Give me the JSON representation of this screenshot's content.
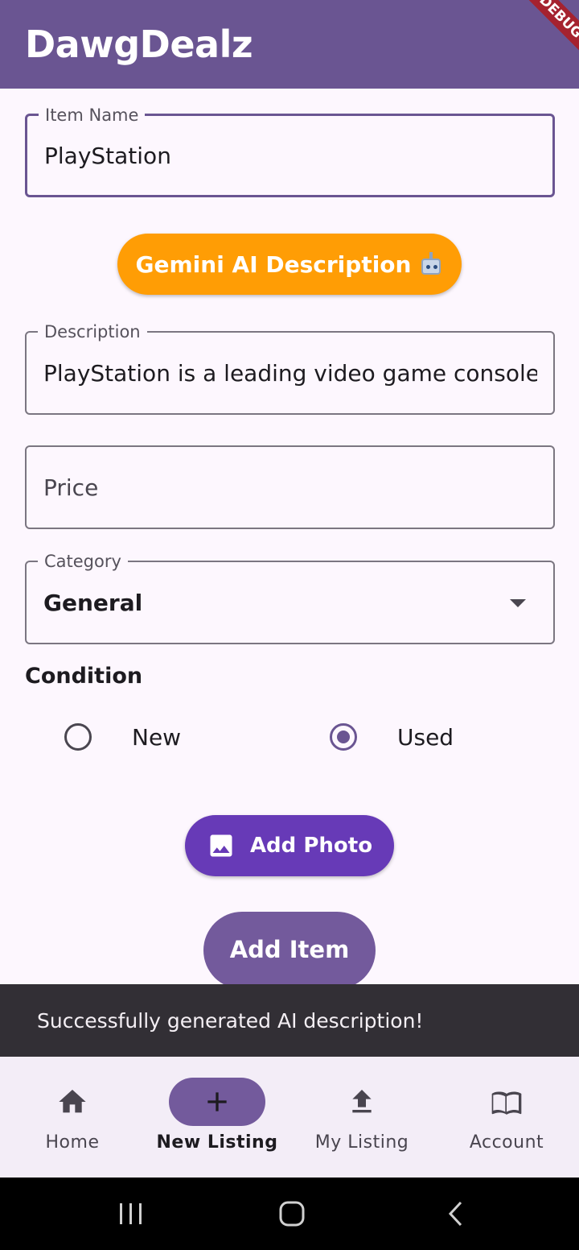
{
  "app": {
    "title": "DawgDealz",
    "debug_banner": "DEBUG"
  },
  "form": {
    "item_name": {
      "label": "Item Name",
      "value": "PlayStation"
    },
    "gemini_button": {
      "label": "Gemini AI Description",
      "icon": "robot-icon"
    },
    "description": {
      "label": "Description",
      "value": "PlayStation is a leading video game console"
    },
    "price": {
      "placeholder": "Price"
    },
    "category": {
      "label": "Category",
      "value": "General"
    },
    "condition": {
      "title": "Condition",
      "options": [
        {
          "label": "New",
          "selected": false
        },
        {
          "label": "Used",
          "selected": true
        }
      ]
    },
    "add_photo_button": {
      "label": "Add Photo",
      "icon": "image-icon"
    },
    "add_item_button": {
      "label": "Add Item"
    }
  },
  "snackbar": {
    "message": "Successfully generated AI description!"
  },
  "bottom_nav": {
    "items": [
      {
        "label": "Home",
        "icon": "home-icon",
        "active": false
      },
      {
        "label": "New Listing",
        "icon": "add-icon",
        "active": true
      },
      {
        "label": "My Listing",
        "icon": "upload-icon",
        "active": false
      },
      {
        "label": "Account",
        "icon": "book-icon",
        "active": false
      }
    ]
  },
  "colors": {
    "app_bar": "#6a5592",
    "gemini_button": "#ff9d05",
    "add_photo_button": "#673ab7",
    "add_item_button": "#735a9c",
    "snackbar": "#322f35",
    "nav_bar": "#f3edf7"
  }
}
